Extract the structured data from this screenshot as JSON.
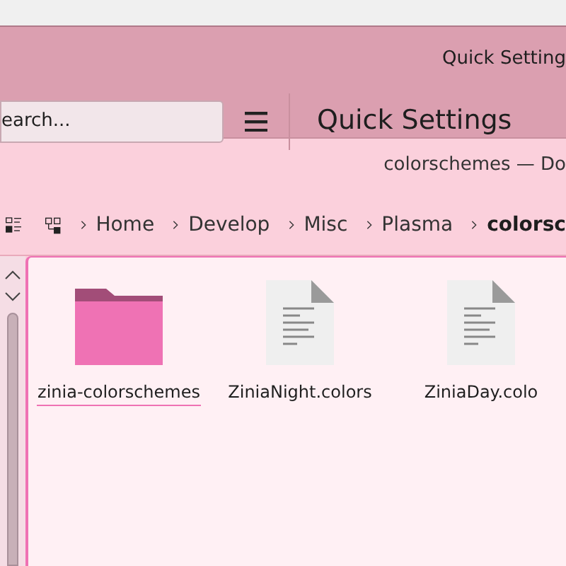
{
  "panel_title": "Quick Setting",
  "search": {
    "placeholder": "earch..."
  },
  "header_title": "Quick Settings",
  "window": {
    "title": "colorschemes — Do"
  },
  "breadcrumbs": [
    {
      "label": "Home",
      "current": false
    },
    {
      "label": "Develop",
      "current": false
    },
    {
      "label": "Misc",
      "current": false
    },
    {
      "label": "Plasma",
      "current": false
    },
    {
      "label": "colorsc",
      "current": true
    }
  ],
  "files": [
    {
      "name": "zinia-colorschemes",
      "kind": "folder",
      "selected": true
    },
    {
      "name": "ZiniaNight.colors",
      "kind": "document",
      "selected": false
    },
    {
      "name": "ZiniaDay.colo",
      "kind": "document",
      "selected": false
    }
  ]
}
